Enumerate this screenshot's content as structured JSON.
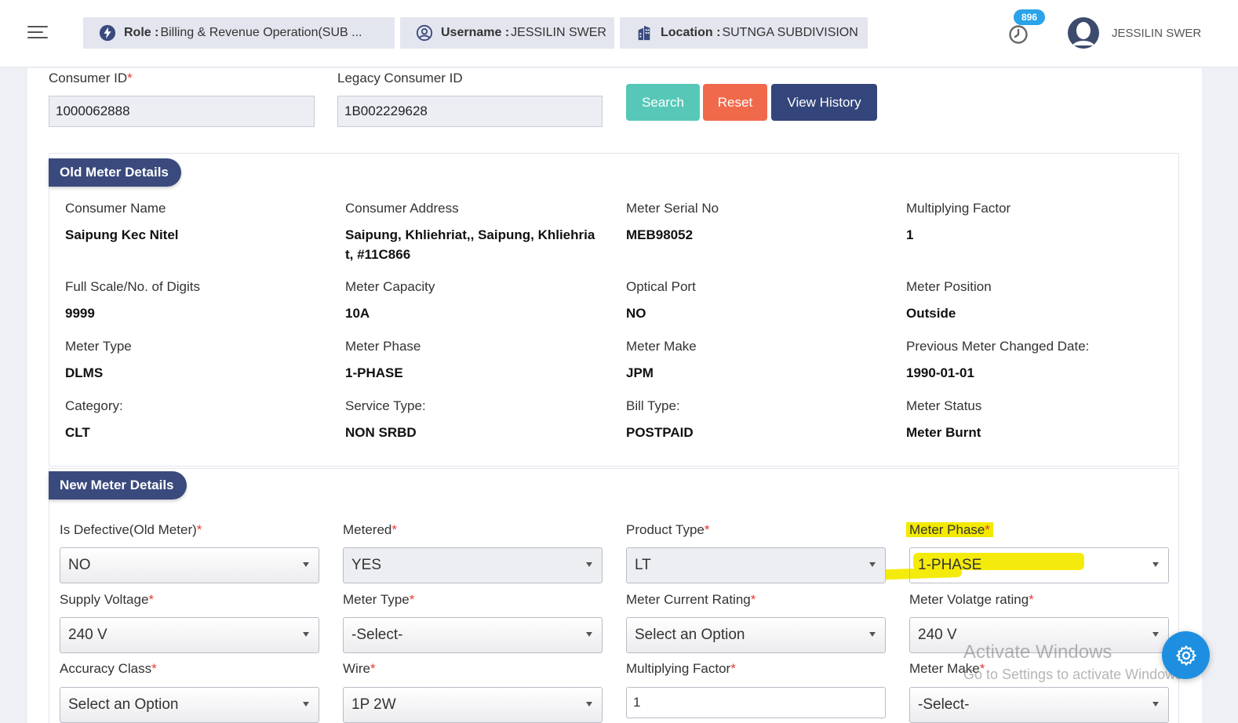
{
  "header": {
    "role_label": "Role :",
    "role_value": "Billing & Revenue Operation(SUB ...",
    "username_label": "Username :",
    "username_value": "JESSILIN SWER",
    "location_label": "Location :",
    "location_value": "SUTNGA SUBDIVISION",
    "notification_count": "896",
    "user_name": "JESSILIN SWER"
  },
  "search": {
    "consumer_id_label": "Consumer ID",
    "consumer_id_value": "1000062888",
    "legacy_id_label": "Legacy Consumer ID",
    "legacy_id_value": "1B002229628",
    "search_button": "Search",
    "reset_button": "Reset",
    "history_button": "View History"
  },
  "old_meter": {
    "title": "Old Meter Details",
    "fields": [
      {
        "label": "Consumer Name",
        "value": "Saipung Kec Nitel"
      },
      {
        "label": "Consumer Address",
        "value": "Saipung, Khliehriat,, Saipung, Khliehria t, #11C866"
      },
      {
        "label": "Meter Serial No",
        "value": "MEB98052"
      },
      {
        "label": "Multiplying Factor",
        "value": "1"
      },
      {
        "label": "Full Scale/No. of Digits",
        "value": "9999"
      },
      {
        "label": "Meter Capacity",
        "value": "10A"
      },
      {
        "label": "Optical Port",
        "value": "NO"
      },
      {
        "label": "Meter Position",
        "value": "Outside"
      },
      {
        "label": "Meter Type",
        "value": "DLMS"
      },
      {
        "label": "Meter Phase",
        "value": "1-PHASE"
      },
      {
        "label": "Meter Make",
        "value": "JPM"
      },
      {
        "label": "Previous Meter Changed Date:",
        "value": "1990-01-01"
      },
      {
        "label": "Category:",
        "value": "CLT"
      },
      {
        "label": "Service Type:",
        "value": "NON SRBD"
      },
      {
        "label": "Bill Type:",
        "value": "POSTPAID"
      },
      {
        "label": "Meter Status",
        "value": "Meter Burnt"
      }
    ]
  },
  "new_meter": {
    "title": "New Meter Details",
    "fields": [
      {
        "label": "Is Defective(Old Meter)",
        "value": "NO"
      },
      {
        "label": "Metered",
        "value": "YES"
      },
      {
        "label": "Product Type",
        "value": "LT"
      },
      {
        "label": "Meter Phase",
        "value": "1-PHASE"
      },
      {
        "label": "Supply Voltage",
        "value": "240 V"
      },
      {
        "label": "Meter Type",
        "value": "-Select-"
      },
      {
        "label": "Meter Current Rating",
        "value": "Select an Option"
      },
      {
        "label": "Meter Volatge rating",
        "value": "240 V"
      },
      {
        "label": "Accuracy Class",
        "value": "Select an Option"
      },
      {
        "label": "Wire",
        "value": "1P 2W"
      },
      {
        "label": "Multiplying Factor",
        "value": "1"
      },
      {
        "label": "Meter Make",
        "value": "-Select-"
      }
    ]
  },
  "watermark": {
    "line1": "Activate Windows",
    "line2": "Go to Settings to activate Windows."
  },
  "colors": {
    "primary": "#3a4a7d",
    "search": "#57c8b8",
    "reset": "#f1694b",
    "required": "#e53935",
    "highlight": "#f3ea00",
    "fab": "#1e8fe0"
  },
  "icons": {
    "menu": "hamburger-icon",
    "role": "bolt-icon",
    "user": "user-circle-icon",
    "location": "building-icon",
    "notifications": "clock-icon",
    "settings": "gear-icon"
  }
}
